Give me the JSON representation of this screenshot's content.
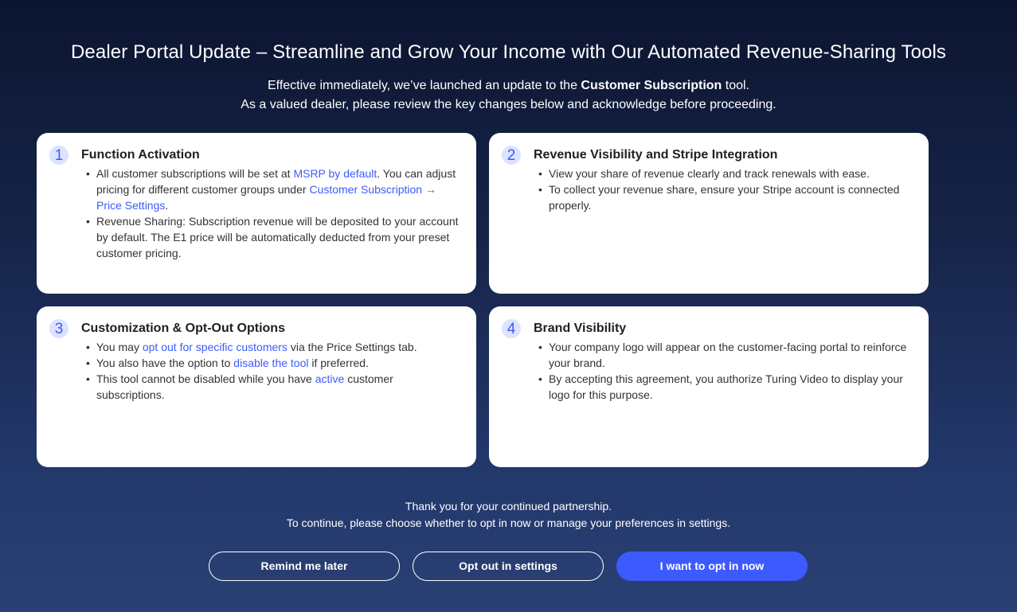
{
  "title": "Dealer Portal Update – Streamline and Grow Your Income with Our Automated Revenue-Sharing Tools",
  "intro": {
    "line1_prefix": "Effective immediately, we’ve launched an update to the ",
    "line1_bold": "Customer Subscription",
    "line1_suffix": " tool.",
    "line2": "As a valued dealer, please review the key changes below and acknowledge before proceeding."
  },
  "cards": [
    {
      "number": "1",
      "title": "Function Activation",
      "items": [
        {
          "p1": "All customer subscriptions will be set at ",
          "l1": "MSRP by default",
          "p2": ". You can adjust pricing for different customer groups under ",
          "l2": "Customer Subscription → Price Settings",
          "p3": "."
        },
        {
          "text": "Revenue Sharing: Subscription revenue will be deposited to your account by default. The E1 price will be automatically deducted from your preset customer pricing."
        }
      ]
    },
    {
      "number": "2",
      "title": "Revenue Visibility and Stripe Integration",
      "items": [
        {
          "text": "View your share of revenue clearly and track renewals with ease."
        },
        {
          "text": "To collect your revenue share, ensure your Stripe account is connected properly."
        }
      ]
    },
    {
      "number": "3",
      "title": "Customization & Opt-Out Options",
      "items": [
        {
          "p1": "You may ",
          "l1": "opt out for specific customers",
          "p2": " via the Price Settings tab."
        },
        {
          "p1": "You also have the option to ",
          "l1": "disable the tool",
          "p2": " if preferred."
        },
        {
          "p1": "This tool cannot be disabled while you have ",
          "l1": "active",
          "p2": " customer subscriptions."
        }
      ]
    },
    {
      "number": "4",
      "title": "Brand Visibility",
      "items": [
        {
          "text": "Your company logo will appear on the customer-facing portal to reinforce your brand."
        },
        {
          "text": "By accepting this agreement, you authorize Turing Video to display your logo for this purpose."
        }
      ]
    }
  ],
  "footer": {
    "line1": "Thank you for your continued partnership.",
    "line2": "To continue, please choose whether to opt in now or manage your preferences in settings."
  },
  "buttons": {
    "remind": "Remind me later",
    "opt_out": "Opt out in settings",
    "opt_in": "I want to opt in now"
  },
  "colors": {
    "accent": "#3d5afe",
    "number_badge_bg": "#dde3ff",
    "background_top": "#0c1530",
    "background_bottom": "#2a4175"
  }
}
